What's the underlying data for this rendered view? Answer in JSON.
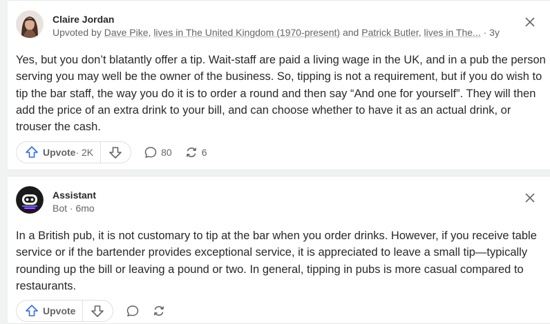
{
  "answers": [
    {
      "author": "Claire Jordan",
      "meta": {
        "prefix": "Upvoted by ",
        "upvoter1": "Dave Pike",
        "sep1": ", ",
        "cred1": "lives in The United Kingdom (1970-present)",
        "and": " and ",
        "upvoter2": "Patrick Butler",
        "sep2": ", ",
        "cred2": "lives in The...",
        "time": " · 3y"
      },
      "body": "Yes, but you don’t blatantly offer a tip. Wait-staff are paid a living wage in the UK, and in a pub the person serving you may well be the owner of the business. So, tipping is not a requirement, but if you do wish to tip the bar staff, the way you do it is to order a round and then say “And one for yourself”. They will then add the price of an extra drink to your bill, and can choose whether to have it as an actual drink, or trouser the cash.",
      "upvote_label": "Upvote",
      "upvote_count": " · 2K",
      "comment_count": "80",
      "share_count": "6"
    },
    {
      "author": "Assistant",
      "meta_text": "Bot · 6mo",
      "body": "In a British pub, it is not customary to tip at the bar when you order drinks. However, if you receive table service or if the bartender provides exceptional service, it is appreciated to leave a small tip—typically rounding up the bill or leaving a pound or two. In general, tipping in pubs is more casual compared to restaurants.",
      "upvote_label": "Upvote"
    }
  ],
  "colors": {
    "icon_blue": "#2e69ff",
    "icon_gray": "#636466",
    "text": "#282829",
    "bot_avatar": "#1a1a1a",
    "bot_accent": "#7b5cff"
  },
  "icons": [
    "close-icon",
    "upvote-arrow-icon",
    "downvote-arrow-icon",
    "comment-icon",
    "share-icon"
  ]
}
